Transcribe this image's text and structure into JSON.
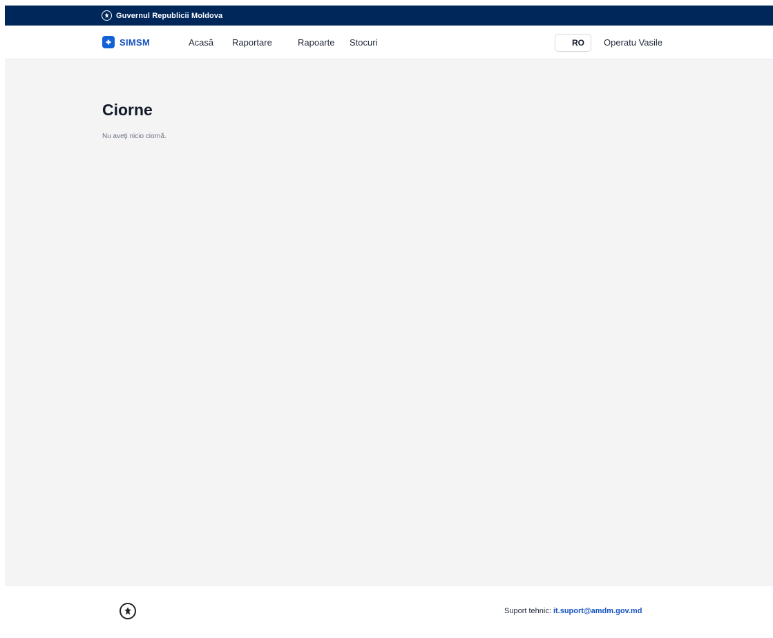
{
  "gov_bar": {
    "title": "Guvernul Republicii Moldova",
    "icon": "moldova-emblem-icon"
  },
  "header": {
    "brand": {
      "name": "SIMSM",
      "icon": "medical-cross-icon",
      "color": "#1553c0"
    },
    "nav": [
      {
        "label": "Acasă"
      },
      {
        "label": "Raportare"
      },
      {
        "label": "Rapoarte"
      },
      {
        "label": "Stocuri"
      }
    ],
    "language": "RO",
    "user": "Operatu Vasile"
  },
  "main": {
    "title": "Ciorne",
    "empty_message": "Nu aveți nicio ciornă."
  },
  "footer": {
    "emblem_icon": "moldova-emblem-icon",
    "support_label": "Suport tehnic:",
    "support_email": "it.suport@amdm.gov.md"
  },
  "colors": {
    "gov_bar_bg": "#00275a",
    "accent": "#1261d6",
    "content_bg": "#f4f4f5"
  }
}
